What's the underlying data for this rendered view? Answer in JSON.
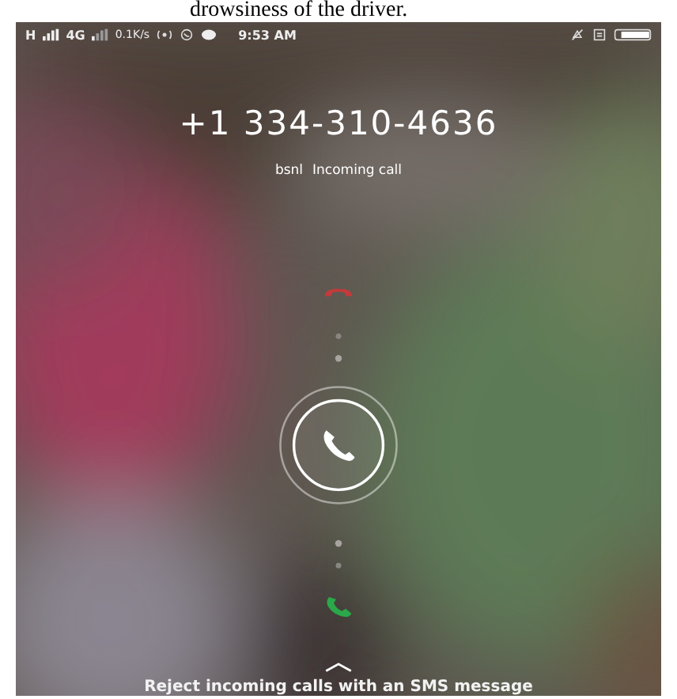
{
  "document_text": "drowsiness of the driver.",
  "status_bar": {
    "network": "H",
    "data_type": "4G",
    "speed": "0.1K/s",
    "time": "9:53 AM"
  },
  "call": {
    "number": "+1 334-310-4636",
    "carrier": "bsnl",
    "status": "Incoming call"
  },
  "reject_sms_hint": "Reject incoming calls with an SMS message"
}
